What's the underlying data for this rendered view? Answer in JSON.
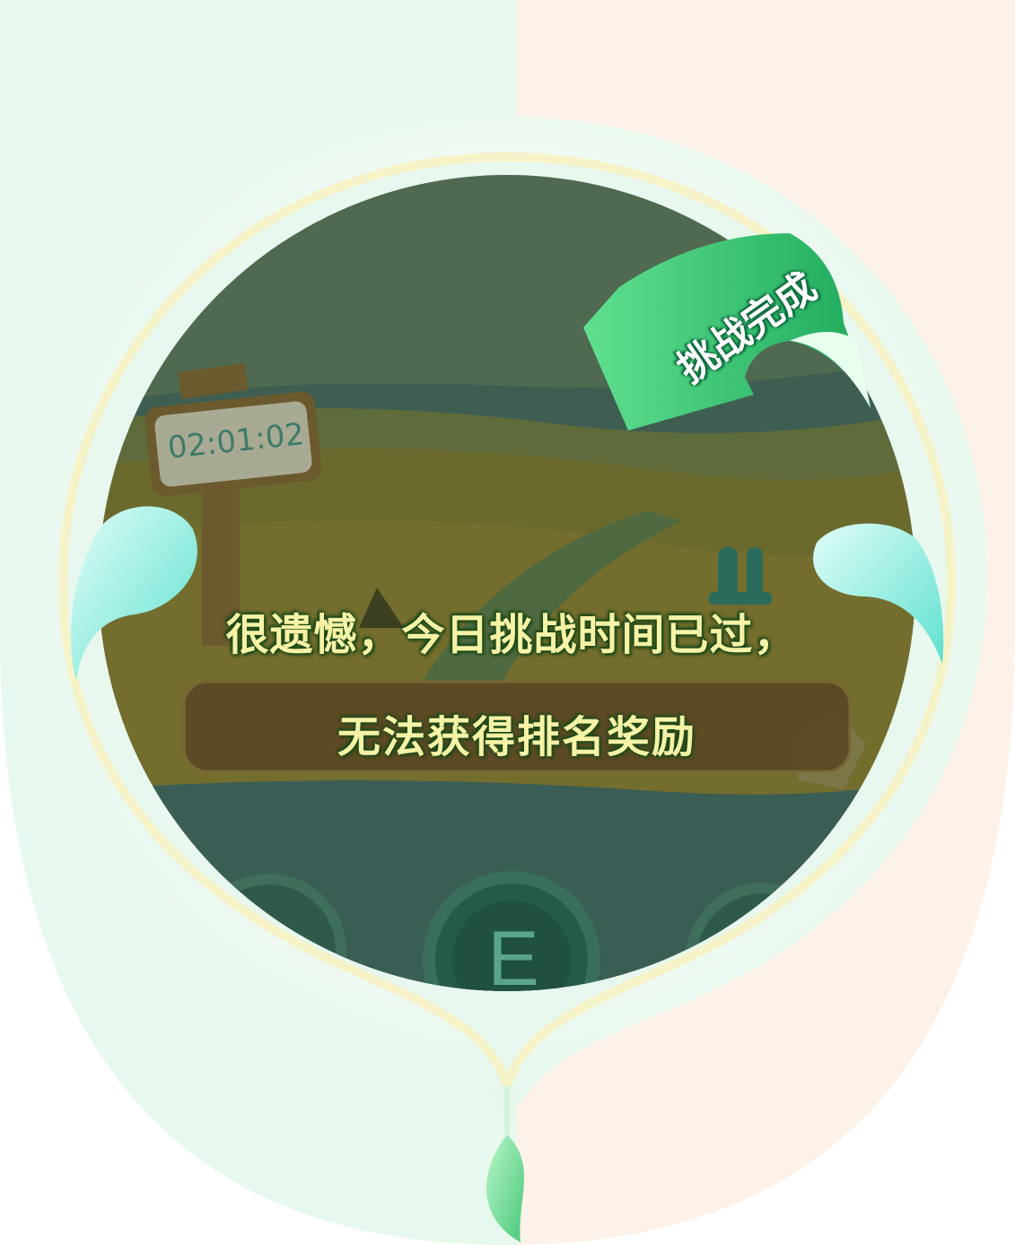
{
  "timer": {
    "display": "02:01:02"
  },
  "badge": {
    "label": "挑战完成"
  },
  "message": {
    "line1": "很遗憾，今日挑战时间已过，",
    "line2": "无法获得排名奖励"
  },
  "level_buttons": [
    {
      "letter": ""
    },
    {
      "letter": "E"
    },
    {
      "letter": ""
    }
  ],
  "colors": {
    "bg_left": "#e6f8ec",
    "bg_right": "#fdf1e9",
    "overlay": "#2f5a48",
    "badge_green": "#2fbf6a",
    "text_yellow": "#f6f2a6"
  }
}
